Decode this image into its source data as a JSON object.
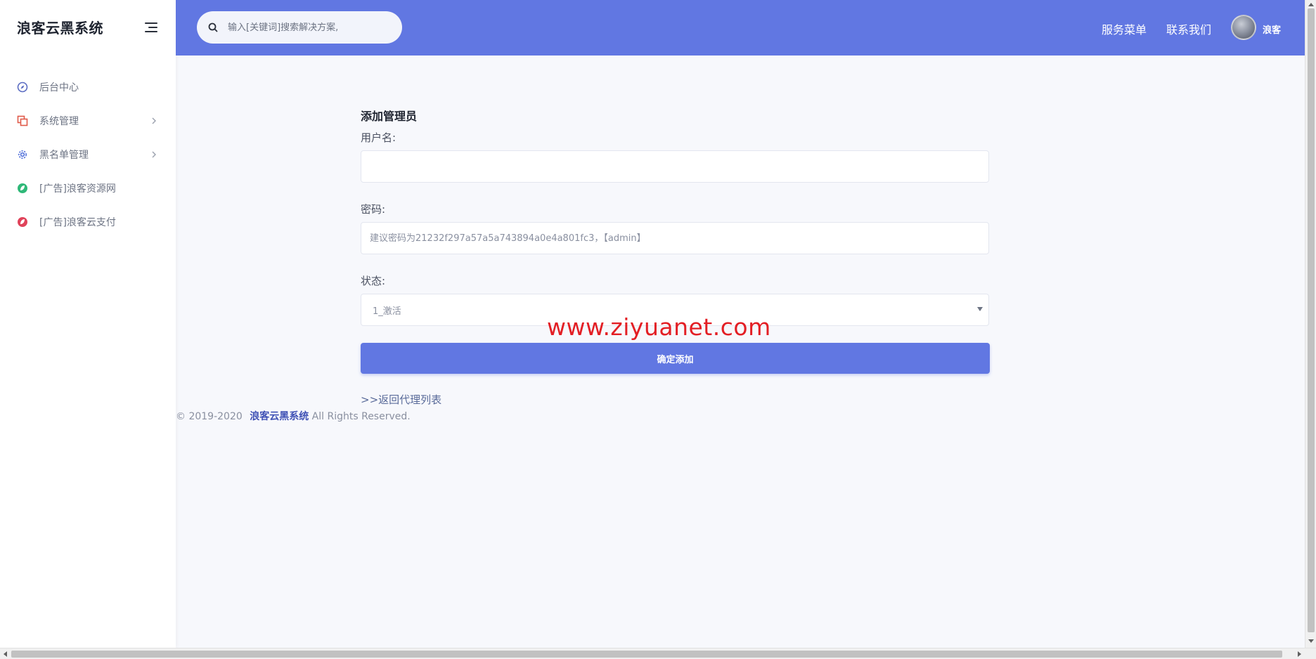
{
  "brand": {
    "title": "浪客云黑系统"
  },
  "sidebar": {
    "items": [
      {
        "label": "后台中心",
        "icon": "compass-icon",
        "color": "#5b6cc2",
        "has_submenu": false
      },
      {
        "label": "系统管理",
        "icon": "copy-icon",
        "color": "#e05a4a",
        "has_submenu": true
      },
      {
        "label": "黑名单管理",
        "icon": "gear-icon",
        "color": "#4a6ad8",
        "has_submenu": true
      },
      {
        "label": "[广告]浪客资源网",
        "icon": "leaf-icon",
        "color": "#2fb878",
        "has_submenu": false
      },
      {
        "label": "[广告]浪客云支付",
        "icon": "leaf-icon",
        "color": "#e0435a",
        "has_submenu": false
      }
    ]
  },
  "header": {
    "search_placeholder": "输入[关键词]搜索解决方案,",
    "links": [
      "服务菜单",
      "联系我们"
    ],
    "username": "浪客"
  },
  "form": {
    "title": "添加管理员",
    "username_label": "用户名:",
    "username_value": "",
    "password_label": "密码:",
    "password_placeholder": "建议密码为21232f297a57a5a743894a0e4a801fc3，【admin】",
    "status_label": "状态:",
    "status_selected": "1_激活",
    "submit_label": "确定添加",
    "back_link": ">>返回代理列表"
  },
  "watermark": "www.ziyuanet.com",
  "footer": {
    "copyright": "© 2019-2020",
    "brand": "浪客云黑系统",
    "rights": "All Rights Reserved."
  },
  "colors": {
    "accent": "#6177e2",
    "footer_brand": "#3f51b5",
    "watermark": "#e31e24"
  }
}
